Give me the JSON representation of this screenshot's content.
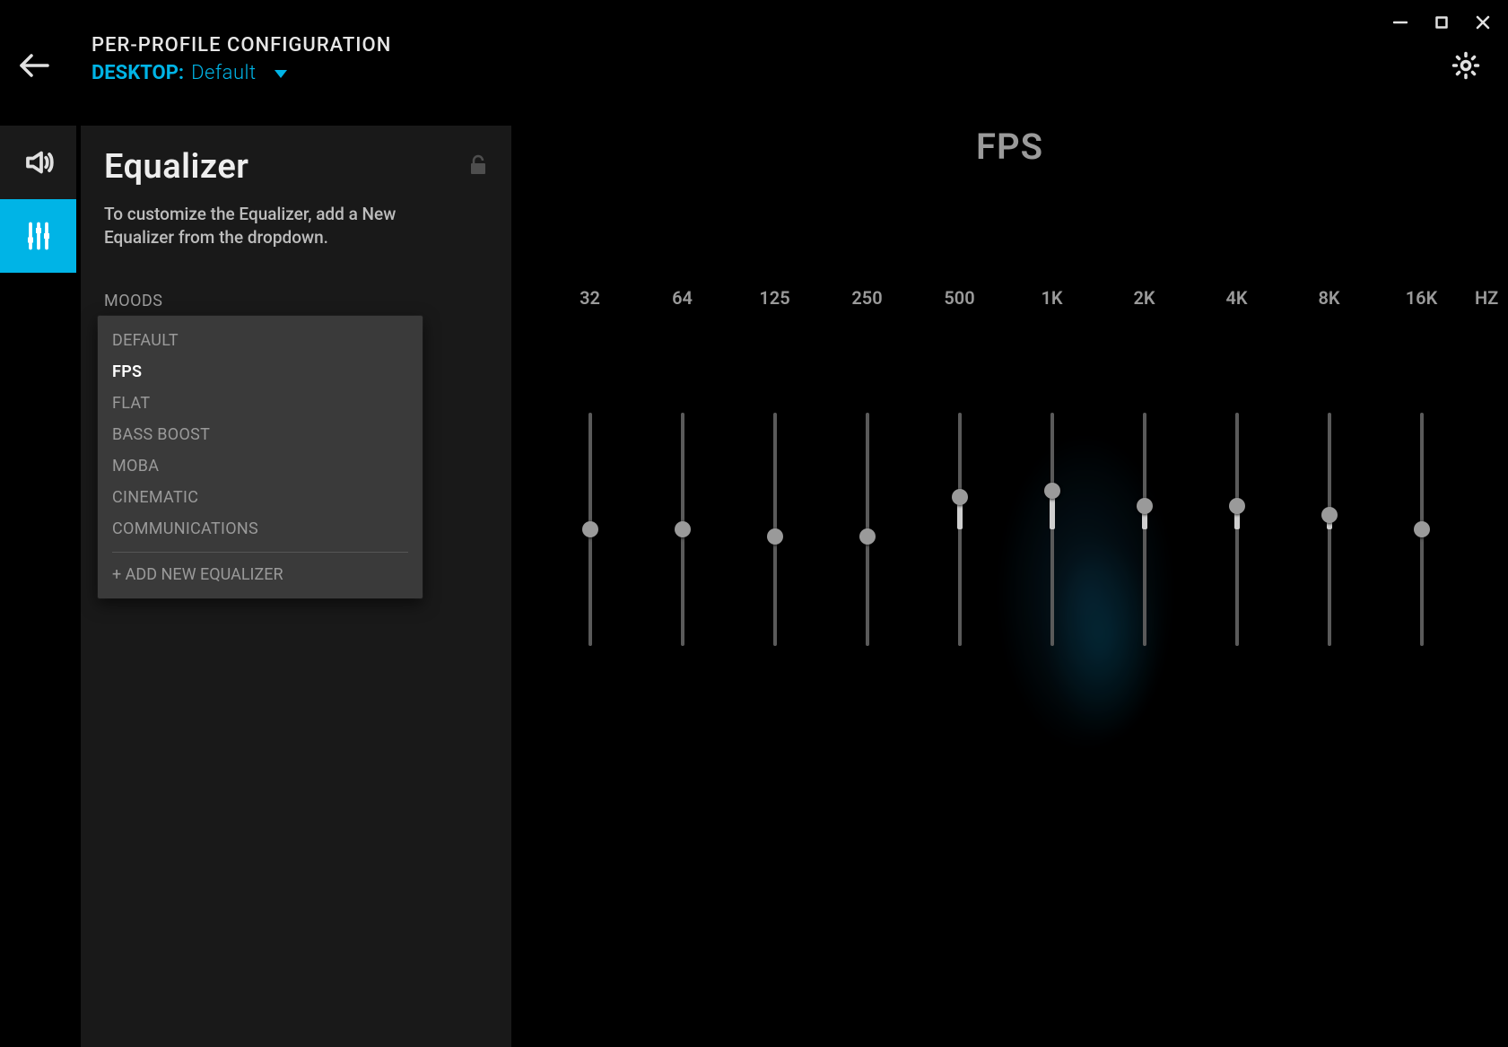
{
  "window": {
    "header_title": "PER-PROFILE CONFIGURATION",
    "profile_prefix": "DESKTOP:",
    "profile_name": "Default"
  },
  "sidebar": {
    "title": "Equalizer",
    "description": "To customize the Equalizer, add a New Equalizer from the dropdown.",
    "moods_label": "MOODS",
    "moods": [
      "DEFAULT",
      "FPS",
      "FLAT",
      "BASS BOOST",
      "MOBA",
      "CINEMATIC",
      "COMMUNICATIONS"
    ],
    "selected_mood": "FPS",
    "add_label": "+ ADD NEW EQUALIZER"
  },
  "equalizer": {
    "preset_title": "FPS",
    "unit_label": "HZ",
    "bands": [
      {
        "label": "32",
        "value": 0
      },
      {
        "label": "64",
        "value": 0
      },
      {
        "label": "125",
        "value": -0.7
      },
      {
        "label": "250",
        "value": -0.7
      },
      {
        "label": "500",
        "value": 3.3
      },
      {
        "label": "1K",
        "value": 4.0
      },
      {
        "label": "2K",
        "value": 2.4
      },
      {
        "label": "4K",
        "value": 2.4
      },
      {
        "label": "8K",
        "value": 1.5
      },
      {
        "label": "16K",
        "value": 0
      }
    ],
    "range_min": -12,
    "range_max": 12
  },
  "colors": {
    "accent": "#00b4e6"
  }
}
